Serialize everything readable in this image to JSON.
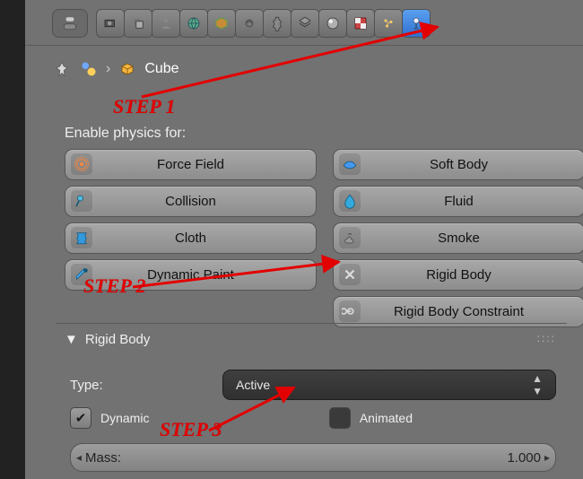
{
  "header": {
    "tabs": [
      {
        "name": "render-icon"
      },
      {
        "name": "render-layers-icon"
      },
      {
        "name": "scene-icon"
      },
      {
        "name": "world-icon"
      },
      {
        "name": "object-icon"
      },
      {
        "name": "constraints-icon"
      },
      {
        "name": "modifiers-icon"
      },
      {
        "name": "data-icon"
      },
      {
        "name": "material-icon"
      },
      {
        "name": "texture-icon"
      },
      {
        "name": "particles-icon"
      },
      {
        "name": "physics-icon"
      }
    ],
    "selected_index": 11
  },
  "breadcrumb": {
    "pin_icon": "pin-icon",
    "scene_icon": "scene-node-icon",
    "sep": "›",
    "obj_icon": "mesh-cube-icon",
    "obj_label": "Cube"
  },
  "enable_label": "Enable physics for:",
  "buttons": [
    {
      "icon": "force-field-icon",
      "label": "Force Field",
      "name": "force-field-button"
    },
    {
      "icon": "soft-body-icon",
      "label": "Soft Body",
      "name": "soft-body-button"
    },
    {
      "icon": "collision-icon",
      "label": "Collision",
      "name": "collision-button"
    },
    {
      "icon": "fluid-icon",
      "label": "Fluid",
      "name": "fluid-button"
    },
    {
      "icon": "cloth-icon",
      "label": "Cloth",
      "name": "cloth-button"
    },
    {
      "icon": "smoke-icon",
      "label": "Smoke",
      "name": "smoke-button"
    },
    {
      "icon": "dynamic-paint-icon",
      "label": "Dynamic Paint",
      "name": "dynamic-paint-button"
    },
    {
      "icon": "rigid-body-icon",
      "label": "Rigid Body",
      "name": "rigid-body-button"
    },
    {
      "icon": "",
      "label": "",
      "name": ""
    },
    {
      "icon": "rigid-body-constraint-icon",
      "label": "Rigid Body Constraint",
      "name": "rigid-body-constraint-button"
    }
  ],
  "rigid_body": {
    "panel_title": "Rigid Body",
    "type_label": "Type:",
    "type_value": "Active",
    "dynamic_label": "Dynamic",
    "dynamic_checked": true,
    "animated_label": "Animated",
    "animated_checked": false,
    "mass_label": "Mass:",
    "mass_value": "1.000"
  },
  "annotations": {
    "step1": "STEP 1",
    "step2": "STEP 2",
    "step3": "STEP 3"
  }
}
